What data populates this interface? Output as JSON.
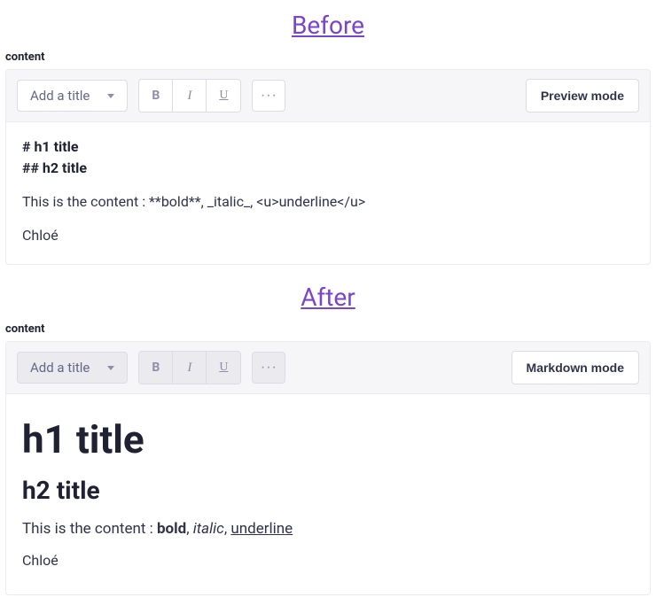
{
  "before": {
    "heading": "Before",
    "field_label": "content",
    "toolbar": {
      "title_dropdown": "Add a title",
      "bold": "B",
      "italic": "I",
      "underline": "U",
      "more": "···",
      "mode_button": "Preview mode"
    },
    "body": {
      "line1": "# h1 title",
      "line2": "## h2 title",
      "content_line": "This is the content : **bold**, _italic_, <u>underline</u>",
      "name": "Chloé"
    }
  },
  "after": {
    "heading": "After",
    "field_label": "content",
    "toolbar": {
      "title_dropdown": "Add a title",
      "bold": "B",
      "italic": "I",
      "underline": "U",
      "more": "···",
      "mode_button": "Markdown mode"
    },
    "body": {
      "h1": "h1 title",
      "h2": "h2 title",
      "content_prefix": "This is the content : ",
      "bold_word": "bold",
      "sep1": ", ",
      "italic_word": "italic",
      "sep2": ", ",
      "underline_word": "underline",
      "name": "Chloé"
    }
  }
}
